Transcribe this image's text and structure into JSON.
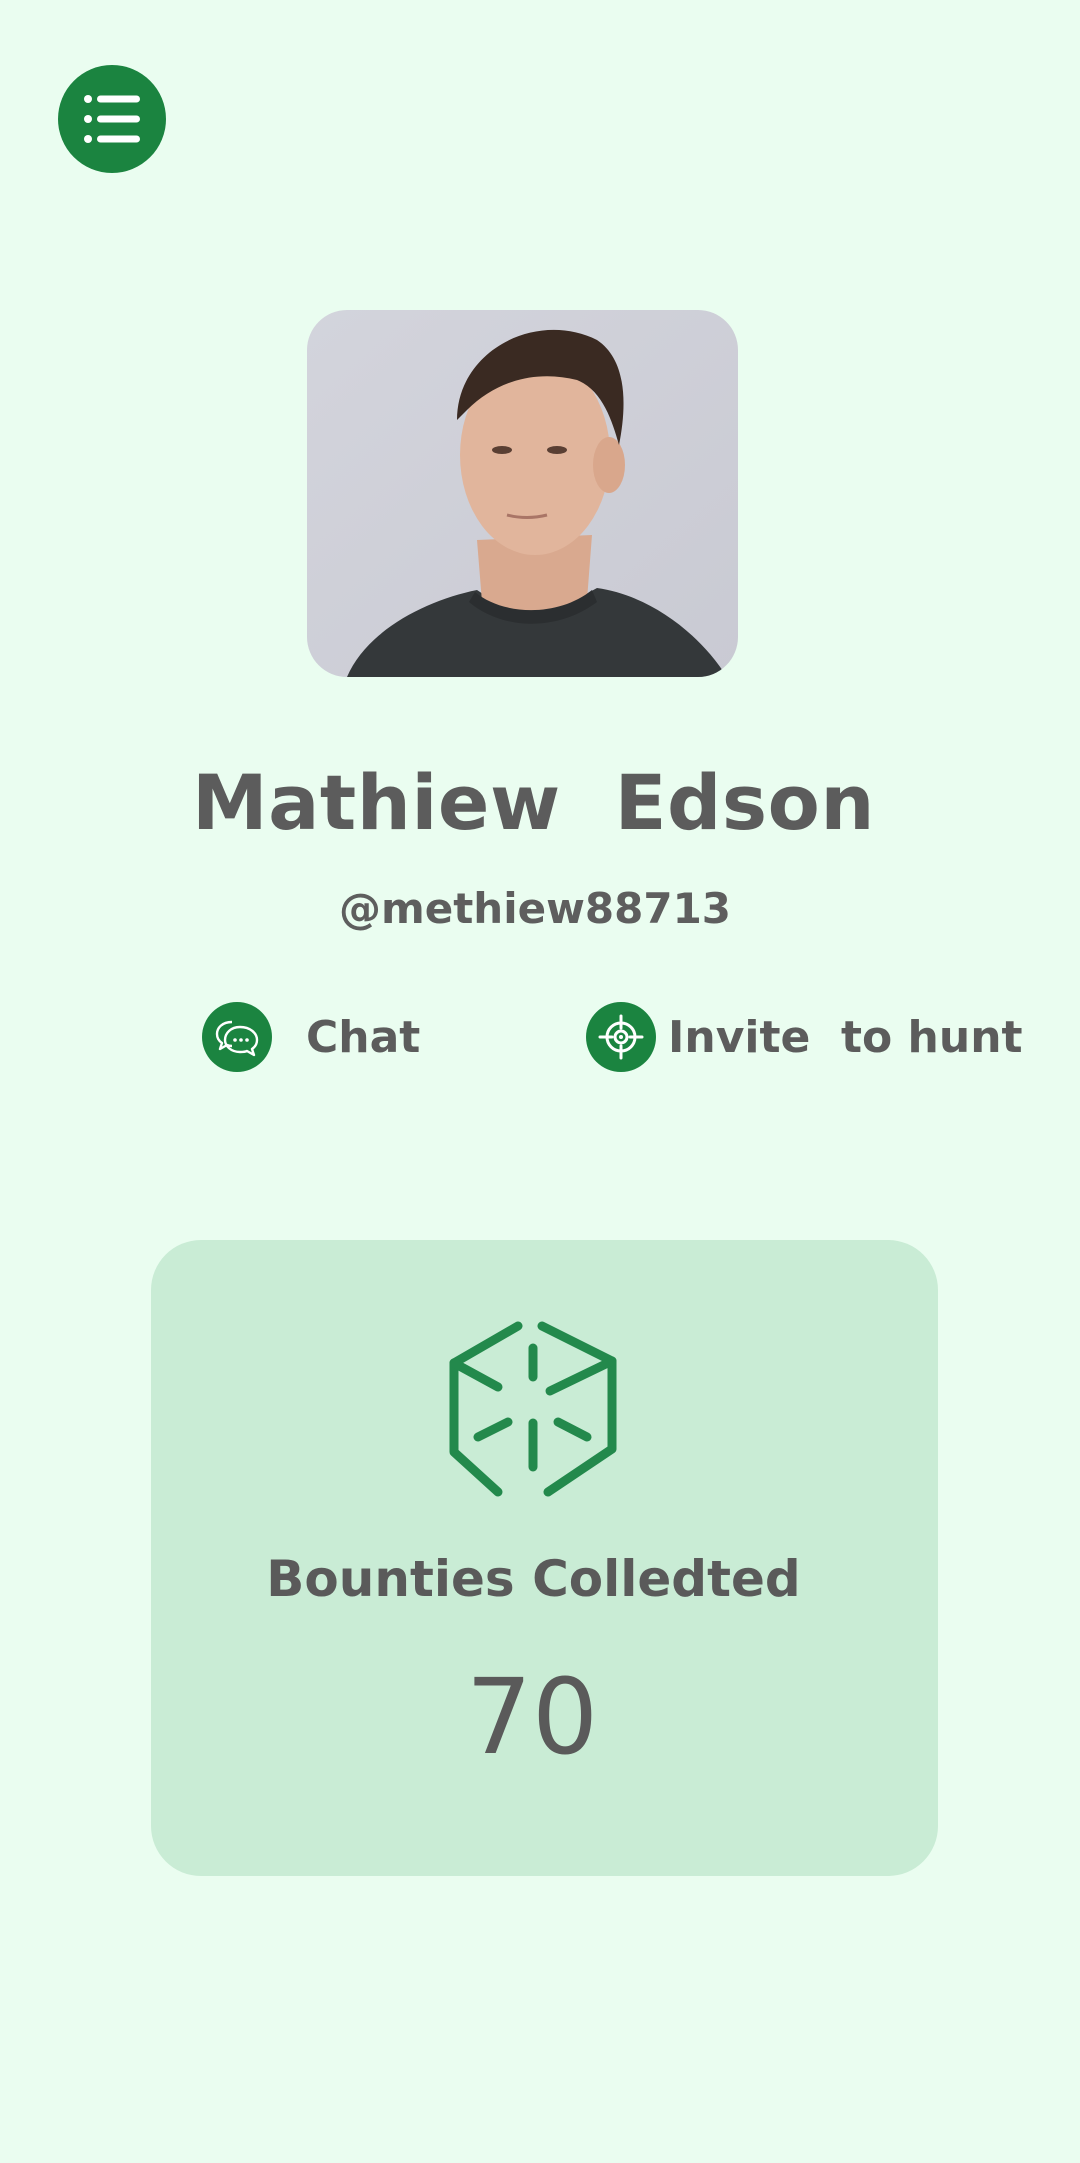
{
  "menu": {
    "icon": "list-menu-icon"
  },
  "profile": {
    "avatar_alt": "Profile photo",
    "name": "Mathiew  Edson",
    "handle": "@methiew88713"
  },
  "actions": {
    "chat": {
      "label": "Chat",
      "icon": "chat-bubbles-icon"
    },
    "invite": {
      "label": "Invite  to hunt",
      "icon": "target-icon"
    }
  },
  "stats": {
    "icon": "cube-icon",
    "label": "Bounties Colledted",
    "value": "70"
  },
  "colors": {
    "background": "#eafdf0",
    "accent": "#1b8440",
    "card": "#c9ecd5",
    "text": "#5a5a5a"
  }
}
